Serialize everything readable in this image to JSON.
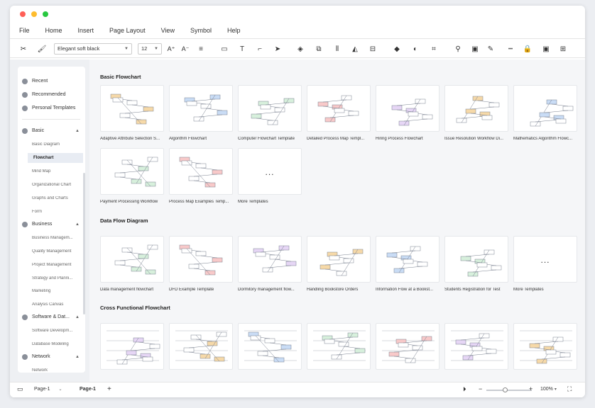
{
  "menu": [
    "File",
    "Home",
    "Insert",
    "Page Layout",
    "View",
    "Symbol",
    "Help"
  ],
  "toolbar": {
    "font": "Elegant soft black",
    "size": "12"
  },
  "sidebar": {
    "top": [
      {
        "label": "Recent"
      },
      {
        "label": "Recommended"
      },
      {
        "label": "Personal Templates"
      }
    ],
    "groups": [
      {
        "label": "Basic",
        "items": [
          "Basic Diagram",
          "Flowchart",
          "Mind Map",
          "Organizational Chart",
          "Graphs and Charts",
          "Form"
        ]
      },
      {
        "label": "Business",
        "items": [
          "Business Managem...",
          "Quality Management",
          "Project Management",
          "Strategy and Planni...",
          "Marketing",
          "Analysis Canvas"
        ]
      },
      {
        "label": "Software & Dat...",
        "items": [
          "Software Developm...",
          "Database Modeling"
        ]
      },
      {
        "label": "Network",
        "items": [
          "Network"
        ]
      }
    ],
    "active_item": "Flowchart"
  },
  "sections": [
    {
      "title": "Basic Flowchart",
      "cards": [
        "Adaptive Attribute Selection S...",
        "Algorithm Flowchart",
        "Computer Flowchart Template",
        "Detailed Process Map Templ...",
        "Hiring Process Flowchart",
        "Issue Resolution Workflow Di...",
        "Mathematics Algorithm Flowc...",
        "Payment Processing Workflow",
        "Process Map Examples Temp...",
        "More Templates"
      ]
    },
    {
      "title": "Data Flow Diagram",
      "cards": [
        "Data management flowchart",
        "DFD Example Template",
        "Dormitory management flow...",
        "Handling Bookstore Orders",
        "Information Flow at a Bookst...",
        "Students Registration for Test",
        "More Templates"
      ]
    },
    {
      "title": "Cross Functional Flowchart",
      "cards": [
        "",
        "",
        "",
        "",
        "",
        "",
        ""
      ]
    }
  ],
  "more_dots": "...",
  "statusbar": {
    "page_select": "Page-1",
    "page_tab": "Page-1",
    "add": "+",
    "minus": "−",
    "plus": "+",
    "zoom": "100%"
  },
  "colors": {
    "red": "#ff5f57",
    "yellow": "#febc2e",
    "green": "#28c840",
    "accent": "#2b5fd9"
  }
}
